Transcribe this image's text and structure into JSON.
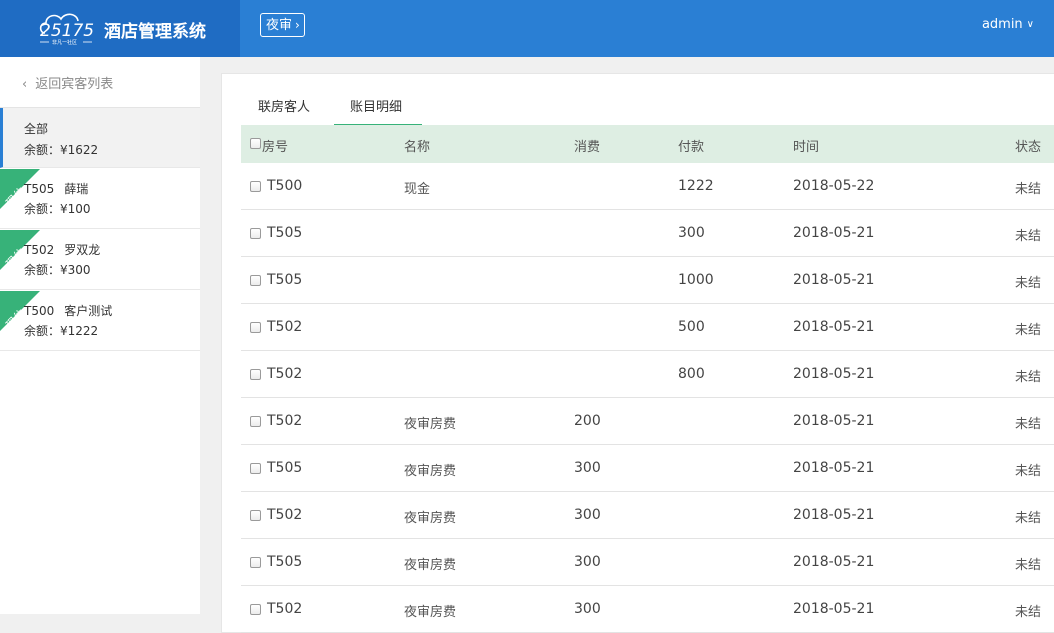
{
  "header": {
    "logo_text": "25175",
    "logo_sub": "非凡一社区",
    "title": "酒店管理系统",
    "night_audit_label": "夜审",
    "user": "admin"
  },
  "sidebar": {
    "back_label": "返回宾客列表",
    "all": {
      "label": "全部",
      "balance": "余额：¥1622"
    },
    "guests": [
      {
        "ribbon": "现住",
        "room": "T505",
        "name": "薛瑞",
        "balance": "余额：¥100"
      },
      {
        "ribbon": "现住",
        "room": "T502",
        "name": "罗双龙",
        "balance": "余额：¥300"
      },
      {
        "ribbon": "现住",
        "room": "T500",
        "name": "客户测试",
        "balance": "余额：¥1222"
      }
    ]
  },
  "tabs": [
    {
      "label": "联房客人",
      "active": false
    },
    {
      "label": "账目明细",
      "active": true
    }
  ],
  "table": {
    "headers": {
      "room": "房号",
      "name": "名称",
      "consume": "消费",
      "payment": "付款",
      "time": "时间",
      "status": "状态"
    },
    "rows": [
      {
        "room": "T500",
        "name": "现金",
        "consume": "",
        "payment": "1222",
        "time": "2018-05-22",
        "status": "未结"
      },
      {
        "room": "T505",
        "name": "",
        "consume": "",
        "payment": "300",
        "time": "2018-05-21",
        "status": "未结"
      },
      {
        "room": "T505",
        "name": "",
        "consume": "",
        "payment": "1000",
        "time": "2018-05-21",
        "status": "未结"
      },
      {
        "room": "T502",
        "name": "",
        "consume": "",
        "payment": "500",
        "time": "2018-05-21",
        "status": "未结"
      },
      {
        "room": "T502",
        "name": "",
        "consume": "",
        "payment": "800",
        "time": "2018-05-21",
        "status": "未结"
      },
      {
        "room": "T502",
        "name": "夜审房费",
        "consume": "200",
        "payment": "",
        "time": "2018-05-21",
        "status": "未结"
      },
      {
        "room": "T505",
        "name": "夜审房费",
        "consume": "300",
        "payment": "",
        "time": "2018-05-21",
        "status": "未结"
      },
      {
        "room": "T502",
        "name": "夜审房费",
        "consume": "300",
        "payment": "",
        "time": "2018-05-21",
        "status": "未结"
      },
      {
        "room": "T505",
        "name": "夜审房费",
        "consume": "300",
        "payment": "",
        "time": "2018-05-21",
        "status": "未结"
      },
      {
        "room": "T502",
        "name": "夜审房费",
        "consume": "300",
        "payment": "",
        "time": "2018-05-21",
        "status": "未结"
      }
    ]
  },
  "colors": {
    "header": "#2a7fd4",
    "brand": "#1f6cc3",
    "accent": "#37b279",
    "thead": "#deeee3"
  }
}
